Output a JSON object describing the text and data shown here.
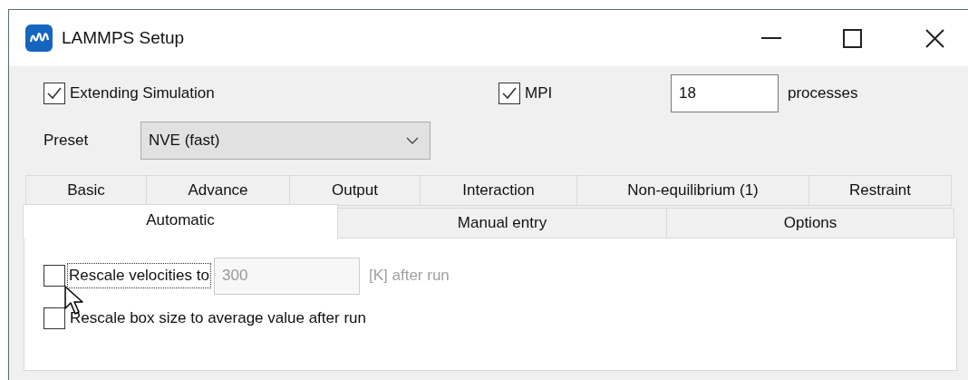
{
  "window": {
    "title": "LAMMPS Setup"
  },
  "extending_simulation": {
    "label": "Extending Simulation",
    "checked": true
  },
  "mpi": {
    "label": "MPI",
    "checked": true
  },
  "processes": {
    "value": "18",
    "unit": "processes"
  },
  "preset": {
    "label": "Preset",
    "value": "NVE (fast)"
  },
  "tab_rows": [
    [
      {
        "label": "Basic",
        "selected": false
      },
      {
        "label": "Advance",
        "selected": false
      },
      {
        "label": "Output",
        "selected": false
      },
      {
        "label": "Interaction",
        "selected": false
      },
      {
        "label": "Non-equilibrium (1)",
        "selected": false
      },
      {
        "label": "Restraint",
        "selected": false
      }
    ],
    [
      {
        "label": "Automatic",
        "selected": true
      },
      {
        "label": "Manual entry",
        "selected": false
      },
      {
        "label": "Options",
        "selected": false
      }
    ]
  ],
  "options": [
    {
      "kind": "value",
      "label": "Rescale velocities to",
      "checked": false,
      "focused": true,
      "value": "300",
      "disabled": true,
      "suffix": "[K] after run"
    },
    {
      "kind": "plain",
      "label": "Rescale box size to average value after run",
      "checked": false,
      "focused": false
    }
  ]
}
